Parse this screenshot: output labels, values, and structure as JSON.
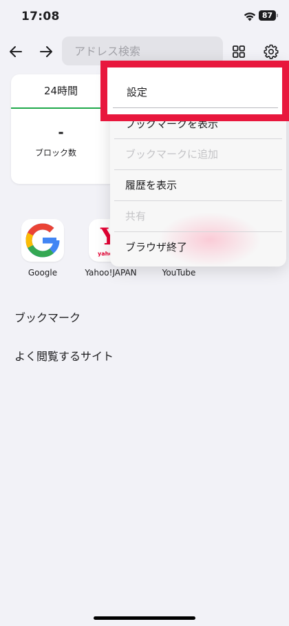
{
  "status_bar": {
    "time": "17:08",
    "battery": "87"
  },
  "address_bar": {
    "placeholder": "アドレス検索"
  },
  "stats_card": {
    "period_tab": "24時間",
    "block_count": "-",
    "block_count_label": "ブロック数"
  },
  "quick_access": [
    {
      "label": "Google",
      "icon": "google-logo"
    },
    {
      "label": "Yahoo!JAPAN",
      "icon": "yahoo-logo",
      "logo_text": "Y",
      "logo_sub": "yahoo"
    },
    {
      "label": "YouTube",
      "icon": "youtube-logo"
    }
  ],
  "sections": {
    "bookmarks": "ブックマーク",
    "frequent": "よく閲覧するサイト"
  },
  "menu": {
    "items": [
      {
        "label": "設定",
        "enabled": true
      },
      {
        "label": "ブックマークを表示",
        "enabled": true
      },
      {
        "label": "ブックマークに追加",
        "enabled": false
      },
      {
        "label": "履歴を表示",
        "enabled": true
      },
      {
        "label": "共有",
        "enabled": false
      },
      {
        "label": "ブラウザ終了",
        "enabled": true
      }
    ]
  },
  "colors": {
    "highlight": "#e8173d",
    "accent_green": "#1ea84a",
    "background": "#f2f2f7"
  }
}
